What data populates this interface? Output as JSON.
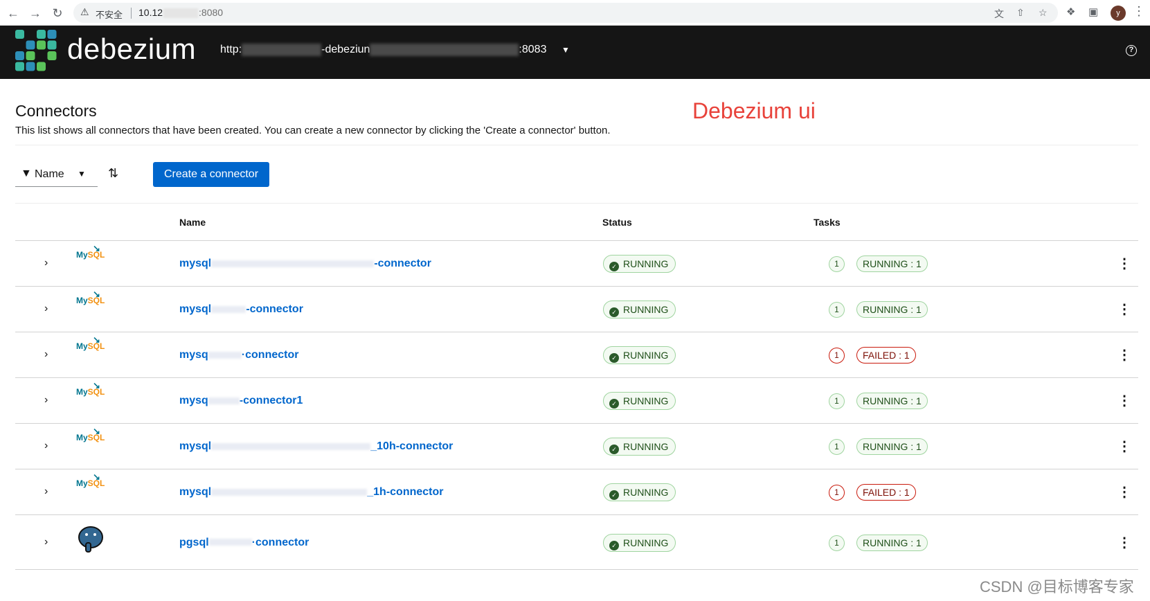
{
  "browser": {
    "back_icon": "arrow-left-icon",
    "forward_icon": "arrow-right-icon",
    "reload_icon": "reload-icon",
    "security_label": "不安全",
    "url_prefix": "10.12",
    "url_port": ":8080"
  },
  "app": {
    "brand": "debezium",
    "cluster_prefix": "http:",
    "cluster_middle": "-debeziun",
    "cluster_port": ":8083",
    "brand_colors": [
      "#3ab9a0",
      "#5ac35a",
      "#2d8fb8"
    ]
  },
  "page": {
    "title": "Connectors",
    "description": "This list shows all connectors that have been created. You can create a new connector by clicking the 'Create a connector' button.",
    "annotation": "Debezium ui"
  },
  "toolbar": {
    "filter_label": "Name",
    "create_label": "Create a connector"
  },
  "table": {
    "headers": {
      "name": "Name",
      "status": "Status",
      "tasks": "Tasks"
    },
    "rows": [
      {
        "db": "MySQL",
        "name_start": "mysql",
        "name_end": "-connector",
        "status": "RUNNING",
        "task_count": "1",
        "task_state": "RUNNING : 1",
        "task_ok": true
      },
      {
        "db": "MySQL",
        "name_start": "mysql",
        "name_end": "-connector",
        "status": "RUNNING",
        "task_count": "1",
        "task_state": "RUNNING : 1",
        "task_ok": true
      },
      {
        "db": "MySQL",
        "name_start": "mysq",
        "name_end": "·connector",
        "status": "RUNNING",
        "task_count": "1",
        "task_state": "FAILED : 1",
        "task_ok": false
      },
      {
        "db": "MySQL",
        "name_start": "mysq",
        "name_end": "-connector1",
        "status": "RUNNING",
        "task_count": "1",
        "task_state": "RUNNING : 1",
        "task_ok": true
      },
      {
        "db": "MySQL",
        "name_start": "mysql",
        "name_end": "_10h-connector",
        "status": "RUNNING",
        "task_count": "1",
        "task_state": "RUNNING : 1",
        "task_ok": true
      },
      {
        "db": "MySQL",
        "name_start": "mysql",
        "name_end": "_1h-connector",
        "status": "RUNNING",
        "task_count": "1",
        "task_state": "FAILED : 1",
        "task_ok": false
      },
      {
        "db": "PostgreSQL",
        "name_start": "pgsql",
        "name_end": "·connector",
        "status": "RUNNING",
        "task_count": "1",
        "task_state": "RUNNING : 1",
        "task_ok": true
      }
    ]
  },
  "watermark": "CSDN @目标博客专家"
}
